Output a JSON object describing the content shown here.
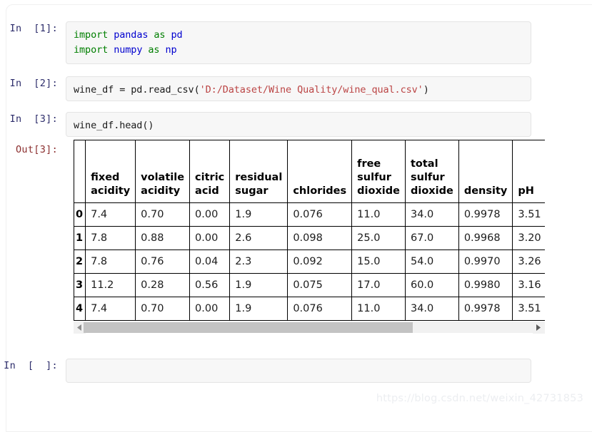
{
  "watermark": "https://blog.csdn.net/weixin_42731853",
  "cells": [
    {
      "prompt": "In  [1]:",
      "type": "code",
      "lines_plain": "import pandas as pd\nimport numpy as np"
    },
    {
      "prompt": "In  [2]:",
      "type": "code",
      "lines_plain": "wine_df = pd.read_csv('D:/Dataset/Wine Quality/wine_qual.csv')"
    },
    {
      "prompt": "In  [3]:",
      "type": "code",
      "lines_plain": "wine_df.head()"
    },
    {
      "prompt": "In  [  ]:",
      "type": "code",
      "lines_plain": ""
    }
  ],
  "cell1": {
    "line1": {
      "kw1": "import",
      "name1": "pandas",
      "kw2": "as",
      "name2": "pd"
    },
    "line2": {
      "kw1": "import",
      "name1": "numpy",
      "kw2": "as",
      "name2": "np"
    }
  },
  "cell2": {
    "lhs": "wine_df = pd.read_csv(",
    "string": "'D:/Dataset/Wine Quality/wine_qual.csv'",
    "rhs": ")"
  },
  "cell3": {
    "code": "wine_df.head()"
  },
  "cell4": {
    "code": ""
  },
  "output": {
    "prompt": "Out[3]:",
    "table": {
      "index_header": "",
      "columns": [
        "fixed acidity",
        "volatile acidity",
        "citric acid",
        "residual sugar",
        "chlorides",
        "free sulfur dioxide",
        "total sulfur dioxide",
        "density",
        "pH"
      ],
      "index": [
        "0",
        "1",
        "2",
        "3",
        "4"
      ],
      "rows": [
        [
          "7.4",
          "0.70",
          "0.00",
          "1.9",
          "0.076",
          "11.0",
          "34.0",
          "0.9978",
          "3.51"
        ],
        [
          "7.8",
          "0.88",
          "0.00",
          "2.6",
          "0.098",
          "25.0",
          "67.0",
          "0.9968",
          "3.20"
        ],
        [
          "7.8",
          "0.76",
          "0.04",
          "2.3",
          "0.092",
          "15.0",
          "54.0",
          "0.9970",
          "3.26"
        ],
        [
          "11.2",
          "0.28",
          "0.56",
          "1.9",
          "0.075",
          "17.0",
          "60.0",
          "0.9980",
          "3.16"
        ],
        [
          "7.4",
          "0.70",
          "0.00",
          "1.9",
          "0.076",
          "11.0",
          "34.0",
          "0.9978",
          "3.51"
        ]
      ]
    },
    "scrollbar": {
      "left_arrow": "scroll-left-arrow",
      "right_arrow": "scroll-right-arrow",
      "thumb_fraction_percent": "73"
    }
  },
  "colors": {
    "keyword": "#007f00",
    "module_name": "#0000cf",
    "string": "#bb4444",
    "in_prompt": "#2d2d6b",
    "out_prompt": "#8b2e2e",
    "cell_background": "#f7f7f7",
    "cell_border": "#e4e4e4",
    "table_border": "#000000",
    "scrollbar_thumb": "#c3c3c3",
    "scrollbar_track": "#f1f1f1",
    "watermark": "#eceef1"
  }
}
